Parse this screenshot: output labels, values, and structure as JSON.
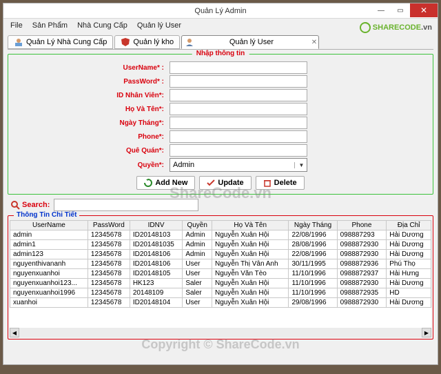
{
  "window": {
    "title": "Quản Lý Admin"
  },
  "menubar": [
    "File",
    "Sản Phẩm",
    "Nhà Cung Cấp",
    "Quản lý User"
  ],
  "logo": {
    "text": "SHARECODE",
    "suffix": ".vn"
  },
  "tabs": [
    {
      "label": "Quản Lý Nhà Cung Cấp"
    },
    {
      "label": "Quản lý kho"
    },
    {
      "label": "Quản lý User"
    }
  ],
  "form": {
    "legend": "Nhập thông tin",
    "fields": {
      "username": "UserName* :",
      "password": "PassWord* :",
      "idnv": "ID Nhân Viên*:",
      "hoten": "Họ Và Tên*:",
      "ngaythang": "Ngày Tháng*:",
      "phone": "Phone*:",
      "quequan": "Quê Quán*:",
      "quyen": "Quyền*:"
    },
    "quyen_value": "Admin",
    "buttons": {
      "add": "Add New",
      "update": "Update",
      "delete": "Delete"
    }
  },
  "search": {
    "label": "Search:"
  },
  "detail": {
    "legend": "Thông Tin Chi Tiết",
    "columns": [
      "UserName",
      "PassWord",
      "IDNV",
      "Quyền",
      "Họ Và Tên",
      "Ngày Tháng",
      "Phone",
      "Địa Chỉ"
    ],
    "rows": [
      [
        "admin",
        "12345678",
        "ID20148103",
        "Admin",
        "Nguyễn Xuân Hội",
        "22/08/1996",
        "098887293",
        "Hải Dương"
      ],
      [
        "admin1",
        "12345678",
        "ID201481035",
        "Admin",
        "Nguyễn Xuân Hội",
        "28/08/1996",
        "0988872930",
        "Hải Dương"
      ],
      [
        "admin123",
        "12345678",
        "ID20148106",
        "Admin",
        "Nguyễn Xuân Hội",
        "22/08/1996",
        "0988872930",
        "Hải Dương"
      ],
      [
        "nguyenthivananh",
        "12345678",
        "ID20148106",
        "User",
        "Nguyễn Thị Vân Anh",
        "30/11/1995",
        "0988872936",
        "Phú Thọ"
      ],
      [
        "nguyenxuanhoi",
        "12345678",
        "ID20148105",
        "User",
        "Nguyễn Văn Tèo",
        "11/10/1996",
        "0988872937",
        "Hải Hưng"
      ],
      [
        "nguyenxuanhoi123...",
        "12345678",
        "HK123",
        "Saler",
        "Nguyễn Xuân Hội",
        "11/10/1996",
        "0988872930",
        "Hải Dương"
      ],
      [
        "nguyenxuanhoi1996",
        "12345678",
        "20148109",
        "Saler",
        "Nguyễn Xuân Hội",
        "11/10/1996",
        "0988872935",
        "HD"
      ],
      [
        "xuanhoi",
        "12345678",
        "ID20148104",
        "User",
        "Nguyễn Xuân Hội",
        "29/08/1996",
        "0988872930",
        "Hải Dương"
      ]
    ]
  },
  "watermark": {
    "top": "ShareCode.vn",
    "bottom": "Copyright © ShareCode.vn"
  }
}
